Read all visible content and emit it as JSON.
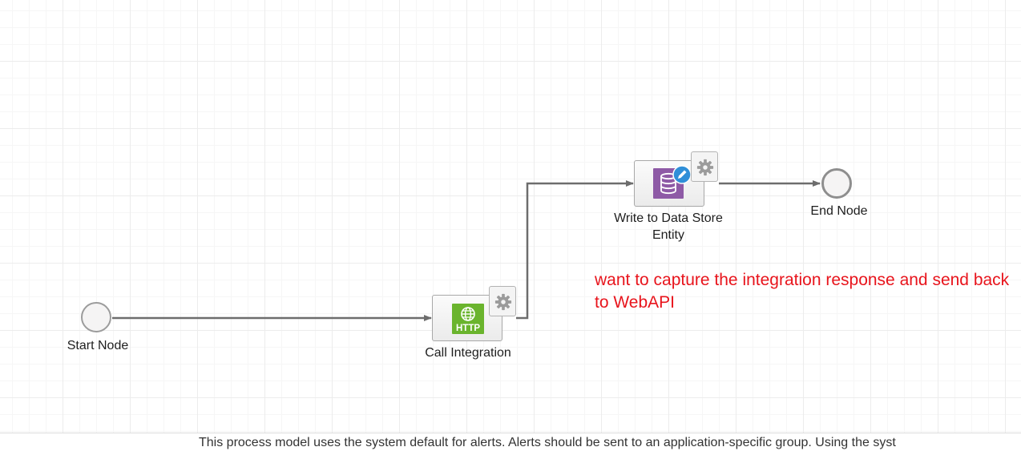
{
  "diagram": {
    "nodes": {
      "start": {
        "label": "Start Node",
        "type": "start-event"
      },
      "call_integration": {
        "label": "Call Integration",
        "type": "integration-task",
        "icon": "http-globe-icon",
        "icon_text": "HTTP"
      },
      "write_datastore": {
        "label": "Write to Data Store Entity",
        "type": "write-datastore-task",
        "icon": "database-icon"
      },
      "end": {
        "label": "End Node",
        "type": "end-event"
      }
    },
    "edges": [
      {
        "from": "Start Node",
        "to": "Call Integration"
      },
      {
        "from": "Call Integration",
        "to": "Write to Data Store Entity"
      },
      {
        "from": "Write to Data Store Entity",
        "to": "End Node"
      }
    ]
  },
  "annotation": {
    "text": "want to capture the integration response and send back to WebAPI",
    "color": "#e8141c"
  },
  "footer": {
    "notice": "This process model uses the system default for alerts. Alerts should be sent to an application-specific group. Using the syst"
  },
  "colors": {
    "http_green": "#6ab42d",
    "datastore_purple": "#8e5aa6",
    "pencil_blue": "#2f8fd8",
    "connector": "#6d6d6d"
  }
}
